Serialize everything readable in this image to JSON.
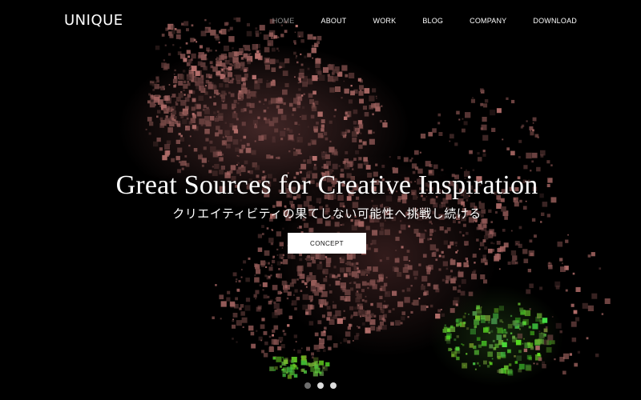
{
  "header": {
    "logo": "UNIQUE",
    "nav": [
      {
        "label": "HOME",
        "active": true
      },
      {
        "label": "ABOUT",
        "active": false
      },
      {
        "label": "WORK",
        "active": false
      },
      {
        "label": "BLOG",
        "active": false
      },
      {
        "label": "COMPANY",
        "active": false
      },
      {
        "label": "DOWNLOAD",
        "active": false
      }
    ]
  },
  "hero": {
    "title": "Great Sources for Creative Inspiration",
    "subtitle": "クリエイティビティの果てしない可能性へ挑戦し続ける",
    "cta_label": "CONCEPT",
    "slider": {
      "count": 3,
      "active_index": 0
    }
  },
  "colors": {
    "background": "#000000",
    "text": "#ffffff",
    "nav_active": "#8c8c8c",
    "button_bg": "#ffffff",
    "button_text": "#111111",
    "particle_reddish": "#a06a6a",
    "particle_green": "#7fd34a"
  }
}
